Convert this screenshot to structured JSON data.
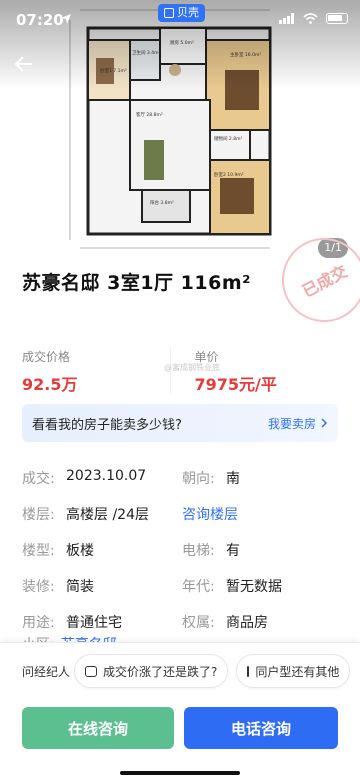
{
  "status_bar": {
    "time": "07:20"
  },
  "brand": {
    "label": "贝壳"
  },
  "gallery": {
    "counter": "1/1"
  },
  "floor_plan": {
    "rooms": [
      {
        "name": "卧室1",
        "area": "7.1m²"
      },
      {
        "name": "卫生间",
        "area": "3.4m²"
      },
      {
        "name": "厨房",
        "area": "5.0m²"
      },
      {
        "name": "主卧室",
        "area": "16.0m²"
      },
      {
        "name": "客厅",
        "area": "28.8m²"
      },
      {
        "name": "储物间",
        "area": "2.8m²"
      },
      {
        "name": "卧室2",
        "area": "10.9m²"
      },
      {
        "name": "阳台",
        "area": "3.8m²"
      }
    ]
  },
  "stamp_text": "已成交",
  "listing": {
    "title": "苏豪名邸 3室1厅 116m²"
  },
  "prices": {
    "deal_label": "成交价格",
    "deal_value": "92.5万",
    "unit_label": "单价",
    "unit_value": "7975元/平"
  },
  "watermark": "@富成钢铁业底",
  "sell_banner": {
    "question": "看看我的房子能卖多少钱?",
    "cta": "我要卖房"
  },
  "details": [
    [
      {
        "label": "成交:",
        "value": "2023.10.07",
        "link": false
      },
      {
        "label": "朝向:",
        "value": "南",
        "link": false
      }
    ],
    [
      {
        "label": "楼层:",
        "value": "高楼层 /24层",
        "link": false
      },
      {
        "label": "",
        "value": "咨询楼层",
        "link": true
      }
    ],
    [
      {
        "label": "楼型:",
        "value": "板楼",
        "link": false
      },
      {
        "label": "电梯:",
        "value": "有",
        "link": false
      }
    ],
    [
      {
        "label": "装修:",
        "value": "简装",
        "link": false
      },
      {
        "label": "年代:",
        "value": "暂无数据",
        "link": false
      }
    ],
    [
      {
        "label": "用途:",
        "value": "普通住宅",
        "link": false
      },
      {
        "label": "权属:",
        "value": "商品房",
        "link": false
      }
    ]
  ],
  "peek": {
    "label": "小区:",
    "value": "苏豪名邸"
  },
  "ask": {
    "label": "问经纪人",
    "chips": [
      "成交价涨了还是跌了?",
      "同户型还有其他"
    ]
  },
  "actions": {
    "online": "在线咨询",
    "phone": "电话咨询"
  },
  "colors": {
    "price": "#e63b3b",
    "link": "#3272f5",
    "online_btn": "#5bbf8f",
    "phone_btn": "#2f6cf4"
  }
}
